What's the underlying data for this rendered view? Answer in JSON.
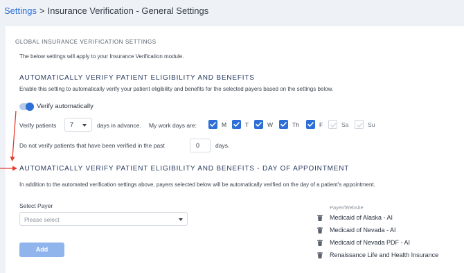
{
  "breadcrumb": {
    "root": "Settings",
    "separator": ">",
    "current": "Insurance Verification - General Settings"
  },
  "global": {
    "title": "GLOBAL INSURANCE VERIFICATION SETTINGS",
    "description": "The below settings will apply to your Insurance Verification module."
  },
  "auto": {
    "title": "AUTOMATICALLY VERIFY PATIENT ELIGIBILITY AND BENEFITS",
    "description": "Enable this setting to automatically verify your patient eligibility and benefits for the selected payers based on the settings below.",
    "toggle_label": "Verify automatically",
    "toggle_on": true,
    "verify_label": "Verify patients",
    "days_select_value": "7",
    "days_in_advance_label": "days in advance.",
    "work_days_label": "My work days are:",
    "days": [
      {
        "label": "M",
        "checked": true
      },
      {
        "label": "T",
        "checked": true
      },
      {
        "label": "W",
        "checked": true
      },
      {
        "label": "Th",
        "checked": true
      },
      {
        "label": "F",
        "checked": true
      },
      {
        "label": "Sa",
        "checked": false
      },
      {
        "label": "Su",
        "checked": false
      }
    ],
    "do_not_verify_label": "Do not verify patients that have been verified in the past",
    "past_days_value": "0",
    "days_label": "days."
  },
  "appointment": {
    "title": "AUTOMATICALLY VERIFY PATIENT ELIGIBILITY AND BENEFITS - DAY OF APPOINTMENT",
    "description": "In addition to the automated verification settings above, payers selected below will be automatically verified on the day of a patient's appointment.",
    "select_payer_label": "Select Payer",
    "select_placeholder": "Please select",
    "add_button": "Add",
    "column_header": "Payer/Website",
    "payers": [
      "Medicaid of Alaska - AI",
      "Medicaid of Nevada - AI",
      "Medicaid of Nevada PDF - AI",
      "Renaissance Life and Health Insurance"
    ]
  },
  "colors": {
    "accent": "#2d6fd6",
    "annotation_arrow": "#e53b2c",
    "button_disabled": "#8fb5ec"
  }
}
